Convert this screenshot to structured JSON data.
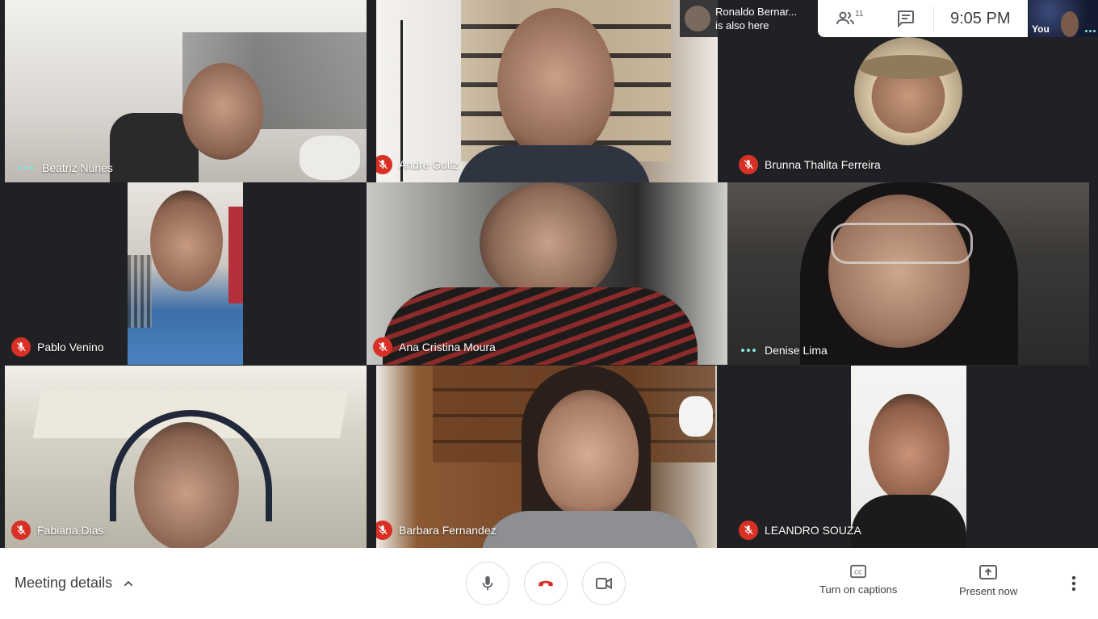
{
  "participants": [
    {
      "name": "Beatriz Nunes",
      "status": "speaking"
    },
    {
      "name": "Andre Goltz",
      "status": "muted"
    },
    {
      "name": "Brunna Thalita Ferreira",
      "status": "muted"
    },
    {
      "name": "Pablo Venino",
      "status": "muted"
    },
    {
      "name": "Ana Cristina Moura",
      "status": "muted"
    },
    {
      "name": "Denise Lima",
      "status": "speaking"
    },
    {
      "name": "Fabiana Dias",
      "status": "muted"
    },
    {
      "name": "Barbara Fernandez",
      "status": "muted"
    },
    {
      "name": "LEANDRO SOUZA",
      "status": "muted"
    }
  ],
  "notification": {
    "name": "Ronaldo Bernar...",
    "message": "is also here"
  },
  "topbar": {
    "people_count": "11",
    "time": "9:05 PM",
    "self_label": "You"
  },
  "bottombar": {
    "meeting_details": "Meeting details",
    "captions_label": "Turn on captions",
    "present_label": "Present now"
  },
  "colors": {
    "mute_red": "#d93025",
    "speaking_teal": "#81e6d9",
    "hangup_red": "#d93025"
  }
}
